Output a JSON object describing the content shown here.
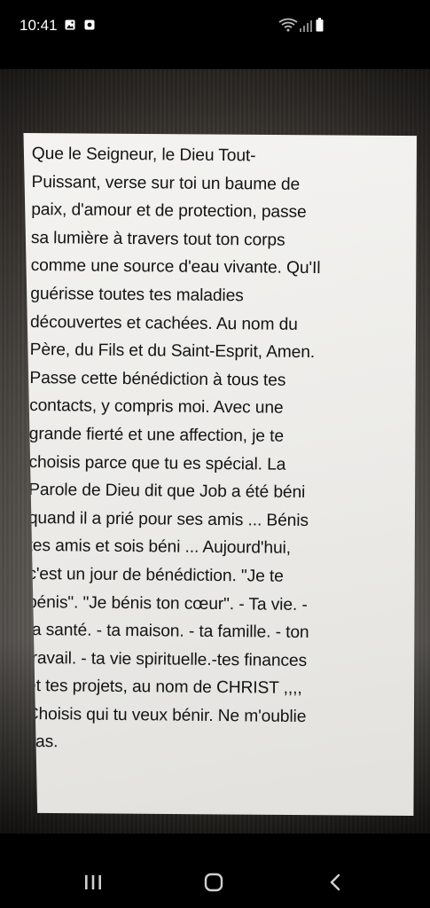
{
  "status_bar": {
    "time": "10:41",
    "icons": [
      "gallery-icon",
      "notification-icon",
      "wifi-icon",
      "signal-icon",
      "battery-icon"
    ]
  },
  "photo": {
    "lines": [
      "Que le Seigneur, le Dieu Tout-",
      "Puissant, verse sur toi un baume de",
      "paix, d'amour et de protection, passe",
      "sa lumière à travers tout ton corps",
      "comme une source d'eau vivante. Qu'Il",
      "guérisse toutes tes maladies",
      "découvertes et cachées. Au nom du",
      "Père, du Fils et du Saint-Esprit, Amen.",
      "Passe cette bénédiction à tous tes",
      "contacts, y compris moi. Avec une",
      "grande fierté et une affection, je te",
      "choisis parce que tu es spécial. La",
      "Parole de Dieu dit que Job a été béni",
      "quand il a prié pour ses amis ... Bénis",
      "tes amis et sois béni ... Aujourd'hui,",
      "c'est un jour de bénédiction. \"Je te",
      "bénis\". \"Je bénis ton cœur\". - Ta vie. -",
      "ta santé. - ta maison. -  ta famille. - ton",
      "travail. - ta vie spirituelle.-tes finances",
      "et tes projets, au nom de CHRIST ,,,,",
      "Choisis qui tu veux bénir. Ne m'oublie",
      "pas."
    ]
  },
  "nav_bar": {
    "buttons": [
      "recents-button",
      "home-button",
      "back-button"
    ]
  },
  "colors": {
    "background": "#000000",
    "paper": "#efeeeb",
    "text": "#141414"
  }
}
